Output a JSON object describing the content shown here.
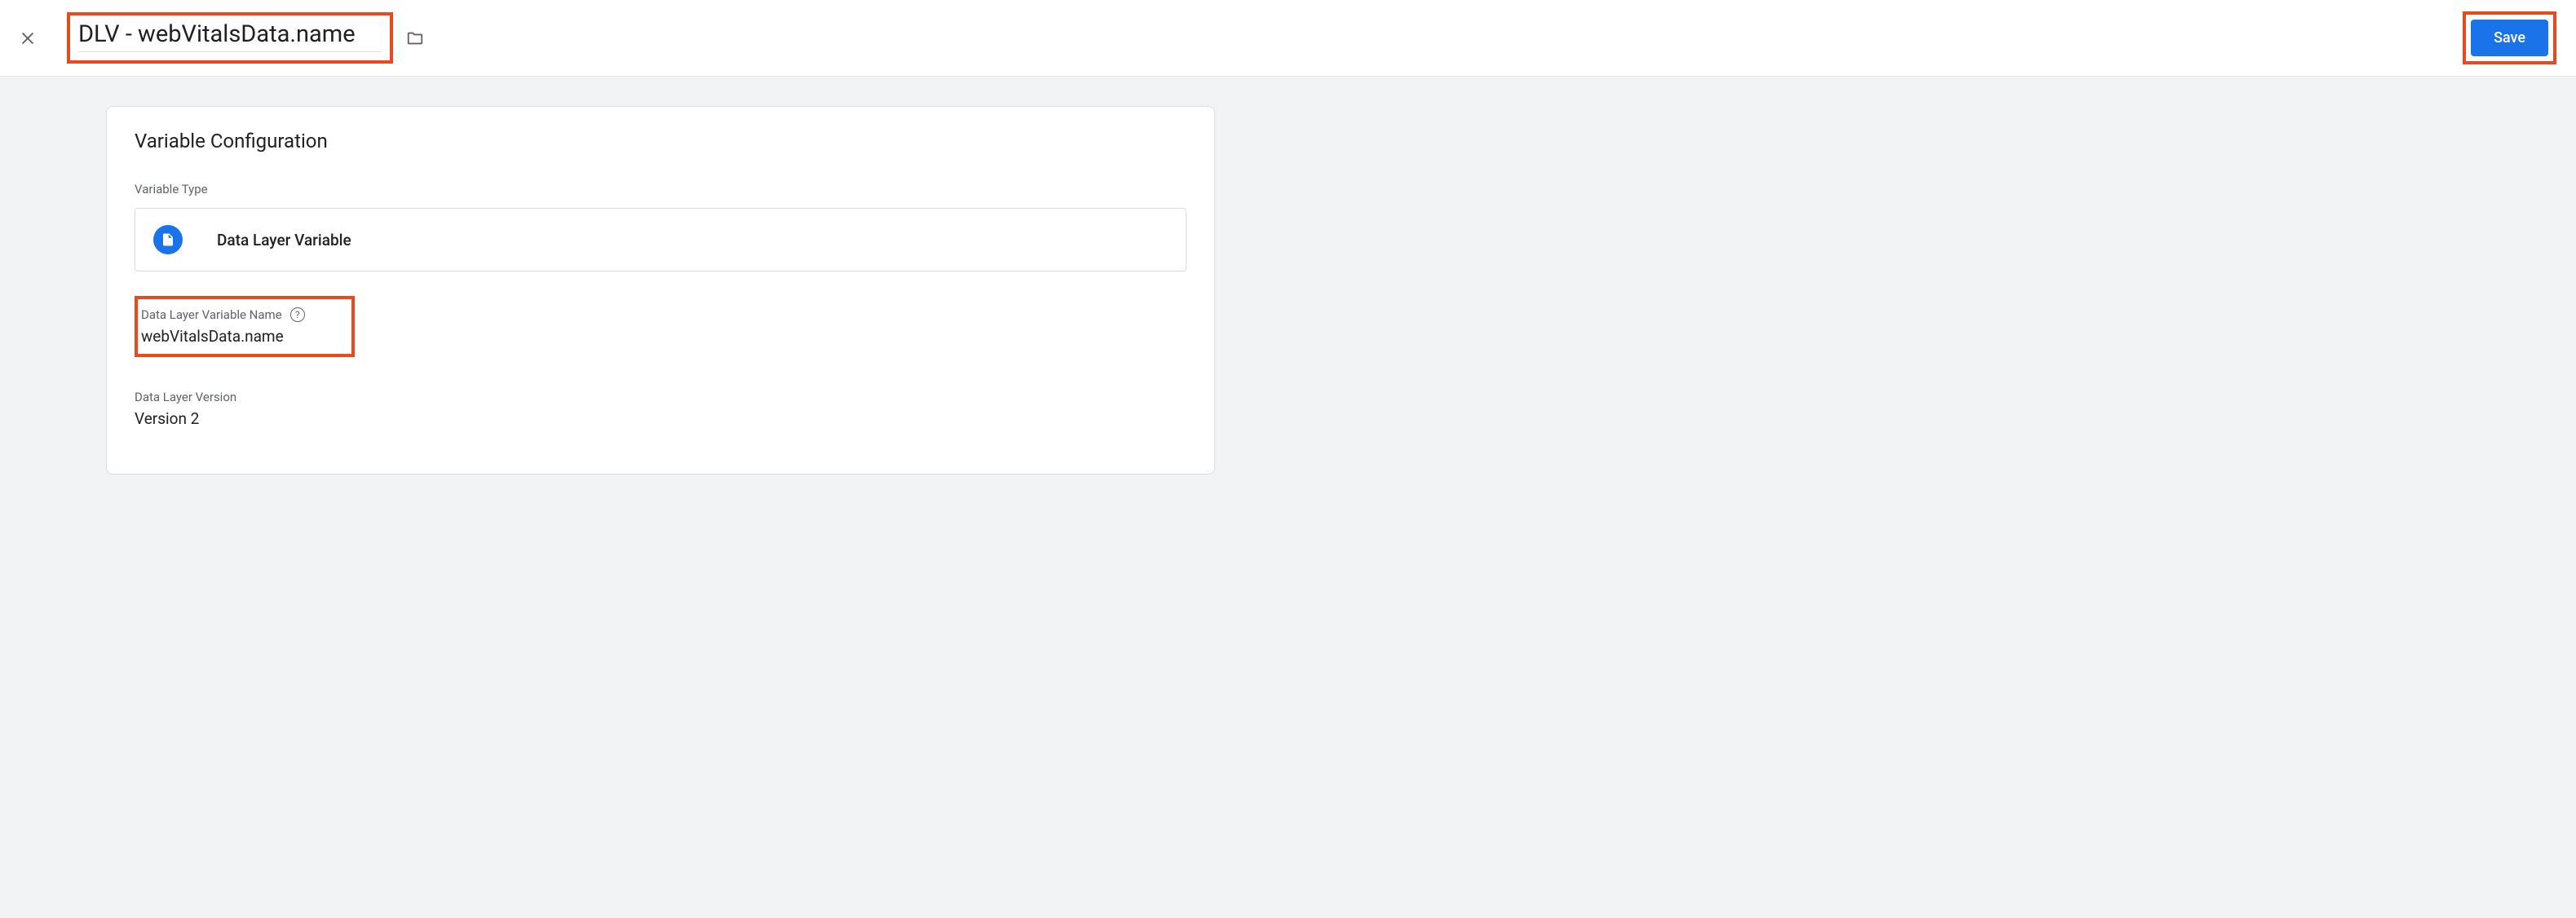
{
  "header": {
    "title": "DLV - webVitalsData.name",
    "save_label": "Save"
  },
  "card": {
    "title": "Variable Configuration",
    "type_section_label": "Variable Type",
    "type_name": "Data Layer Variable",
    "fields": {
      "dlv_name_label": "Data Layer Variable Name",
      "dlv_name_value": "webVitalsData.name",
      "version_label": "Data Layer Version",
      "version_value": "Version 2"
    }
  }
}
